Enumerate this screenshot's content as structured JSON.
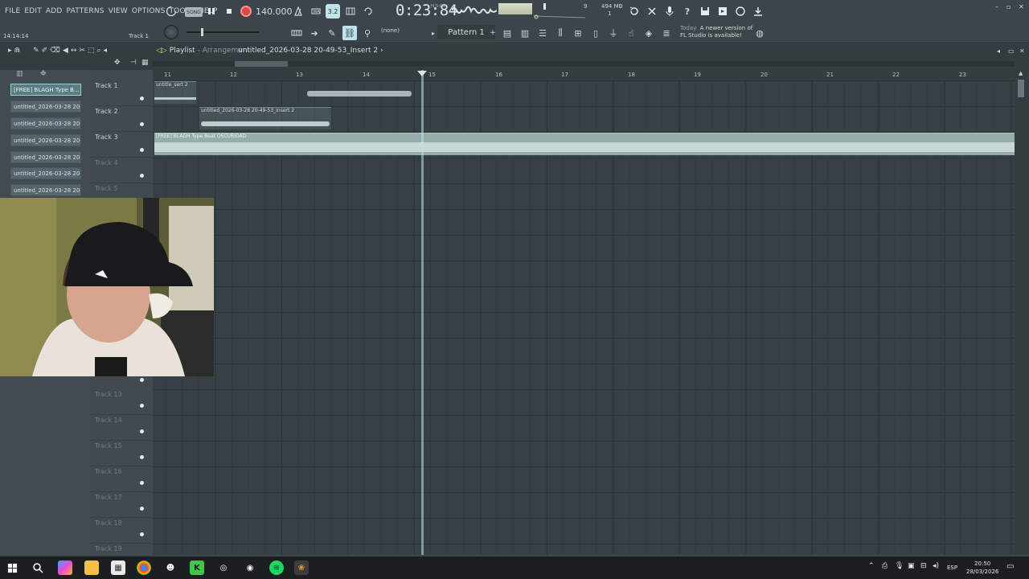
{
  "menus": [
    "FILE",
    "EDIT",
    "ADD",
    "PATTERNS",
    "VIEW",
    "OPTIONS",
    "TOOLS",
    "HELP"
  ],
  "transport": {
    "song_label": "SONG",
    "tempo": "140.000",
    "time": "0:23:84",
    "time_unit": "M:S:CS",
    "cpu": "9",
    "memory": "494 MB",
    "poly": "1"
  },
  "toolbar2": {
    "clock": "14:14:14",
    "track_hint": "Track 1",
    "none_label": "(none)",
    "pattern": "Pattern 1",
    "news_today": "Today",
    "news_line1": "A newer version of",
    "news_line2": "FL Studio is available!"
  },
  "playlist": {
    "title": "Playlist",
    "subtitle": "- Arrangement",
    "crumb": "untitled_2026-03-28 20-49-53_Insert 2",
    "bars": [
      "11",
      "12",
      "13",
      "14",
      "15",
      "16",
      "17",
      "18",
      "19",
      "20",
      "21",
      "22",
      "23"
    ]
  },
  "picker": [
    "[FREE] BLAGH Type B...",
    "untitled_2026-03-28 20-...",
    "untitled_2026-03-28 20-...",
    "untitled_2026-03-28 20-...",
    "untitled_2026-03-28 20-...",
    "untitled_2026-03-28 20-...",
    "untitled_2026-03-28 20-..."
  ],
  "tracks_top": [
    "Track 1",
    "Track 2",
    "Track 3",
    "Track 4",
    "Track 5"
  ],
  "tracks_bottom": [
    "Track 13",
    "Track 14",
    "Track 15",
    "Track 16",
    "Track 17",
    "Track 18",
    "Track 19"
  ],
  "clips": {
    "clip1": "untitle_sert 2",
    "clip2": "untitled_2026-03-28 20-49-53_Insert 2",
    "clip3": "[FREE] BLAGH Type Beat  OSCURIDAD"
  },
  "taskbar": {
    "lang": "ESP",
    "time": "20:50",
    "date": "28/03/2026"
  },
  "colors": {
    "background": "#3d464b",
    "accent": "#8fd3dc",
    "record": "#e0474c",
    "clip_audio": "#95aeab"
  }
}
